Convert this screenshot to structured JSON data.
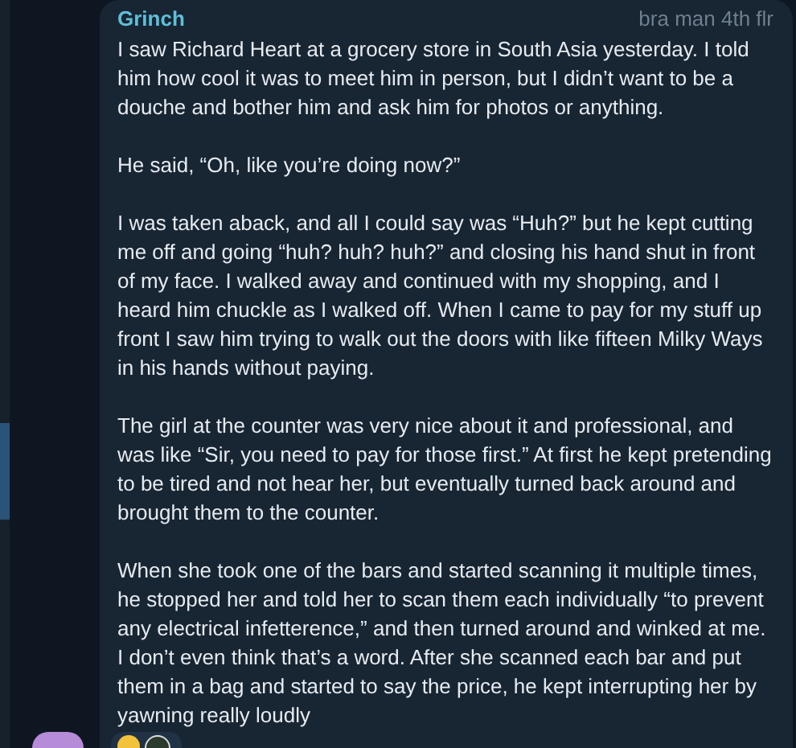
{
  "message": {
    "author": "Grinch",
    "note": "bra man 4th flr",
    "paragraphs": [
      "I saw Richard Heart at a grocery store in South Asia yesterday. I told him how cool it was to meet him in person, but I didn’t want to be a douche and bother him and ask him for photos or anything.",
      "He said, “Oh, like you’re doing now?”",
      "I was taken aback, and all I could say was “Huh?” but he kept cutting me off and going “huh? huh? huh?” and closing his hand shut in front of my face. I walked away and continued with my shopping, and I heard him chuckle as I walked off. When I came to pay for my stuff up front I saw him trying to walk out the doors with like fifteen Milky Ways in his hands without paying.",
      "The girl at the counter was very nice about it and professional, and was like “Sir, you need to pay for those first.” At first he kept pretending to be tired and not hear her, but eventually turned back around and brought them to the counter.",
      "When she took one of the bars and started scanning it multiple times, he stopped her and told her to scan them each individually “to prevent any electrical infetterence,” and then turned around and winked at me. I don’t even think that’s a word. After she scanned each bar and put them in a bag and started to say the price, he kept interrupting her by yawning really loudly"
    ]
  }
}
